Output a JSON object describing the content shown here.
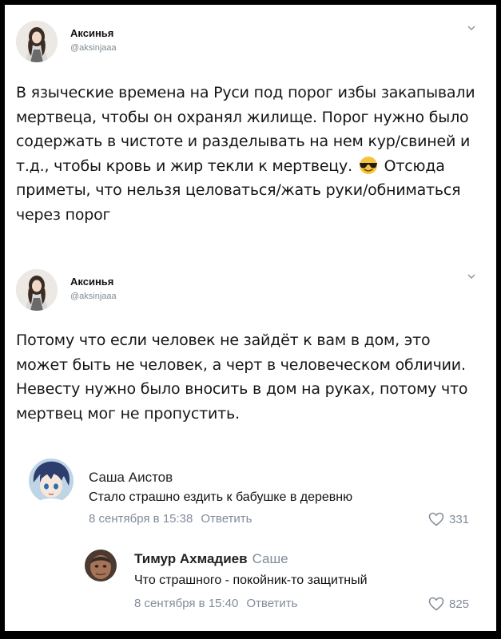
{
  "tweets": [
    {
      "author": "Аксинья",
      "handle": "@aksinjaaa",
      "text_parts": [
        "В языческие времена на Руси под порог избы закапывали мертвеца, чтобы он охранял жилище. Порог нужно было содержать в чистоте и разделывать на нем кур/свиней и т.д., чтобы кровь и жир текли к мертвецу. ",
        " Отсюда приметы, что нельзя целоваться/жать руки/обниматься через порог"
      ],
      "emoji": "smiling-face-with-sunglasses-icon"
    },
    {
      "author": "Аксинья",
      "handle": "@aksinjaaa",
      "text": "Потому что если человек не зайдёт к вам в дом, это может быть не человек, а черт в человеческом обличии. Невесту нужно было вносить в дом на руках, потому что мертвец мог не пропустить."
    }
  ],
  "comments": [
    {
      "name": "Саша Аистов",
      "reply_to": "",
      "text": "Стало страшно ездить к бабушке в деревню",
      "date": "8 сентября в 15:38",
      "reply_label": "Ответить",
      "likes": "331"
    },
    {
      "name": "Тимур Ахмадиев",
      "reply_to": "Саше",
      "text": "Что страшного - покойник-то защитный",
      "date": "8 сентября в 15:40",
      "reply_label": "Ответить",
      "likes": "825"
    }
  ],
  "colors": {
    "secondary_text": "#818c99",
    "handle": "#7f8b93"
  }
}
